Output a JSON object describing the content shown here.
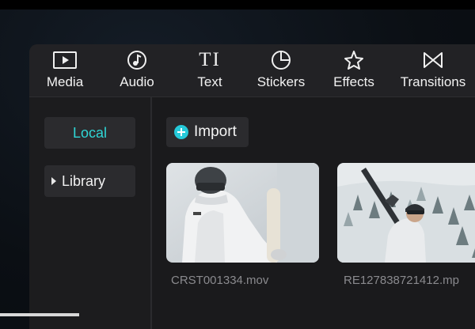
{
  "toolbar": {
    "tabs": [
      {
        "label": "Media",
        "icon": "media-icon"
      },
      {
        "label": "Audio",
        "icon": "audio-icon"
      },
      {
        "label": "Text",
        "icon": "text-icon"
      },
      {
        "label": "Stickers",
        "icon": "stickers-icon"
      },
      {
        "label": "Effects",
        "icon": "effects-icon"
      },
      {
        "label": "Transitions",
        "icon": "transitions-icon"
      }
    ],
    "text_icon_glyph": "TI"
  },
  "sidebar": {
    "items": [
      {
        "label": "Local",
        "active": true
      },
      {
        "label": "Library",
        "active": false
      }
    ]
  },
  "content": {
    "import_label": "Import",
    "media": [
      {
        "filename": "CRST001334.mov"
      },
      {
        "filename": "RE127838721412.mp"
      }
    ]
  },
  "colors": {
    "accent": "#2fd6d6",
    "import_icon": "#25c9d9",
    "panel": "#1b1b1d",
    "toolbar": "#222225"
  }
}
